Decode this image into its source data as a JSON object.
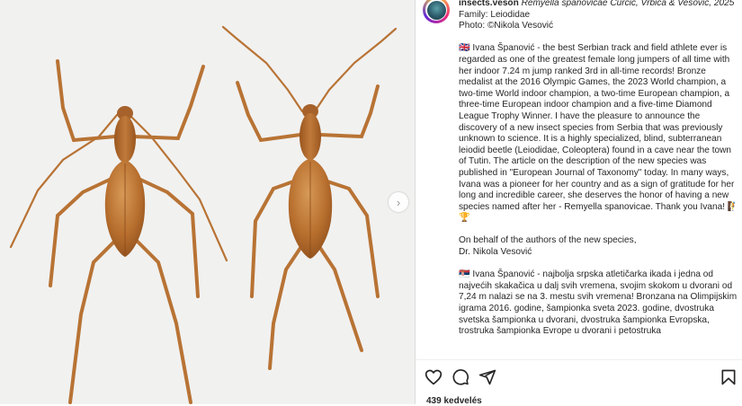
{
  "post": {
    "username": "insects.veson",
    "header_lines": [
      "Remyella spanovicae Čurčić, Vrbica & Vesović, 2025",
      "Family: Leiodidae",
      "Photo: ©Nikola Vesović"
    ],
    "caption_en_flag": "🇬🇧",
    "caption_en": "Ivana Španović - the best Serbian track and field athlete ever is regarded as one of the greatest female long jumpers of all time with her indoor 7.24 m jump ranked 3rd in all-time records! Bronze medalist at the 2016 Olympic Games, the 2023 World champion, a two-time World indoor champion, a two-time European champion, a three-time European indoor champion and a five-time Diamond League Trophy Winner. I have the pleasure to announce the discovery of a new insect species from Serbia that was previously unknown to science. It is a highly specialized, blind, subterranean leiodid beetle (Leiodidae, Coleoptera) found in a cave near the town of Tutin. The article on the description of the new species was published in \"European Journal of Taxonomy\" today. In many ways, Ivana was a pioneer for her country and as a sign of gratitude for her long and incredible career, she deserves the honor of having a new species named after her - Remyella spanovicae. Thank you Ivana! 🧗🏆",
    "signoff": "On behalf of the authors of the new species,\nDr. Nikola Vesović",
    "caption_sr_flag": "🇷🇸",
    "caption_sr": "Ivana Španović - najbolja srpska atletičarka ikada i jedna od najvećih skakačica u dalj svih vremena, svojim skokom u dvorani od 7,24 m nalazi se na 3. mestu svih vremena! Bronzana na Olimpijskim igrama 2016. godine, šampionka sveta 2023. godine, dvostruka svetska šampionka u dvorani, dvostruka šampionka Evropska, trostruka šampionka Evrope u dvorani i petostruka",
    "likes_text": "439 kedvelés"
  },
  "icons": {
    "like": "heart-icon",
    "comment": "comment-icon",
    "share": "share-icon",
    "save": "bookmark-icon",
    "next": "chevron-right-icon"
  },
  "colors": {
    "beetle_body": "#b5702f",
    "beetle_legs": "#c07a3a",
    "background": "#f1f1f0",
    "text": "#262626"
  }
}
